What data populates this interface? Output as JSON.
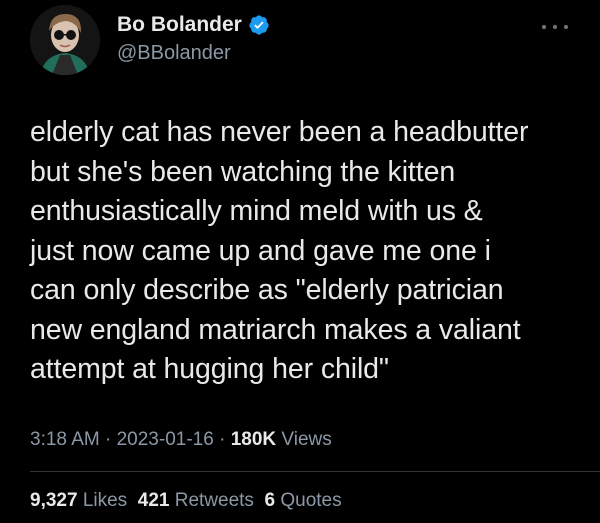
{
  "author": {
    "display_name": "Bo Bolander",
    "handle": "@BBolander",
    "verified": true,
    "verified_color": "#1d9bf0",
    "avatar_icon": "avatar-photo"
  },
  "more_icon": "more-horizontal-icon",
  "tweet": {
    "lines": [
      "elderly cat has never been a headbutter",
      "but she's been watching the kitten",
      "enthusiastically mind meld with us &",
      "just now came up and gave me one i",
      "can only describe as \"elderly patrician",
      "new england matriarch makes a valiant",
      "attempt at hugging her child\""
    ]
  },
  "meta": {
    "time": "3:18 AM",
    "separator": "·",
    "date": "2023-01-16",
    "views_count": "180K",
    "views_label": "Views"
  },
  "stats": {
    "likes_count": "9,327",
    "likes_label": "Likes",
    "retweets_count": "421",
    "retweets_label": "Retweets",
    "quotes_count": "6",
    "quotes_label": "Quotes"
  }
}
